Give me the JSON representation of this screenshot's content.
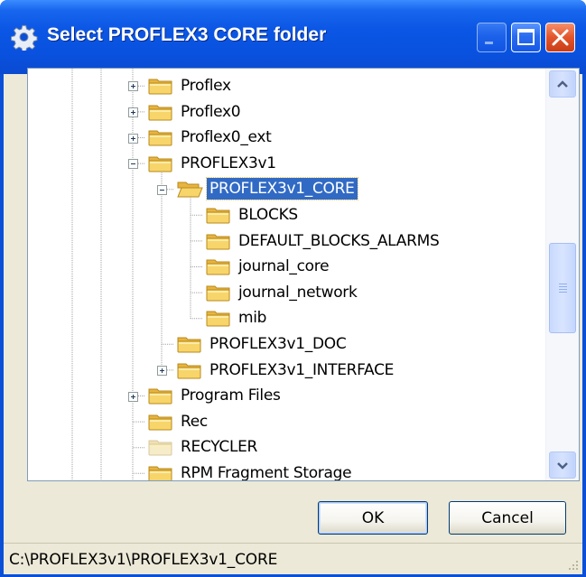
{
  "window": {
    "title": "Select PROFLEX3 CORE folder",
    "title_icon": "gear-icon",
    "controls": [
      "minimize",
      "maximize",
      "close"
    ]
  },
  "tree": {
    "nodes": [
      {
        "label": "Proflex",
        "level": 0,
        "expander": "plus",
        "folder": "closed",
        "selected": false
      },
      {
        "label": "Proflex0",
        "level": 0,
        "expander": "plus",
        "folder": "closed",
        "selected": false
      },
      {
        "label": "Proflex0_ext",
        "level": 0,
        "expander": "plus",
        "folder": "closed",
        "selected": false
      },
      {
        "label": "PROFLEX3v1",
        "level": 0,
        "expander": "minus",
        "folder": "closed",
        "selected": false
      },
      {
        "label": "PROFLEX3v1_CORE",
        "level": 1,
        "expander": "minus",
        "folder": "open",
        "selected": true
      },
      {
        "label": "BLOCKS",
        "level": 2,
        "expander": "none",
        "folder": "closed",
        "selected": false
      },
      {
        "label": "DEFAULT_BLOCKS_ALARMS",
        "level": 2,
        "expander": "none",
        "folder": "closed",
        "selected": false
      },
      {
        "label": "journal_core",
        "level": 2,
        "expander": "none",
        "folder": "closed",
        "selected": false
      },
      {
        "label": "journal_network",
        "level": 2,
        "expander": "none",
        "folder": "closed",
        "selected": false
      },
      {
        "label": "mib",
        "level": 2,
        "expander": "none",
        "folder": "closed",
        "selected": false
      },
      {
        "label": "PROFLEX3v1_DOC",
        "level": 1,
        "expander": "none",
        "folder": "closed",
        "selected": false
      },
      {
        "label": "PROFLEX3v1_INTERFACE",
        "level": 1,
        "expander": "plus",
        "folder": "closed",
        "selected": false
      },
      {
        "label": "Program Files",
        "level": 0,
        "expander": "plus",
        "folder": "closed",
        "selected": false
      },
      {
        "label": "Rec",
        "level": 0,
        "expander": "none",
        "folder": "closed",
        "selected": false
      },
      {
        "label": "RECYCLER",
        "level": 0,
        "expander": "none",
        "folder": "faded",
        "selected": false
      },
      {
        "label": "RPM Fragment Storage",
        "level": 0,
        "expander": "none",
        "folder": "closed",
        "selected": false
      }
    ],
    "scroll_position": 0.55
  },
  "buttons": {
    "ok_label": "OK",
    "cancel_label": "Cancel"
  },
  "status": {
    "path": "C:\\PROFLEX3v1\\PROFLEX3v1_CORE"
  },
  "colors": {
    "title_bar": "#0a4fd8",
    "selection": "#316ac5",
    "dialog_face": "#ece9d8",
    "folder_yellow": "#f7d56a"
  }
}
